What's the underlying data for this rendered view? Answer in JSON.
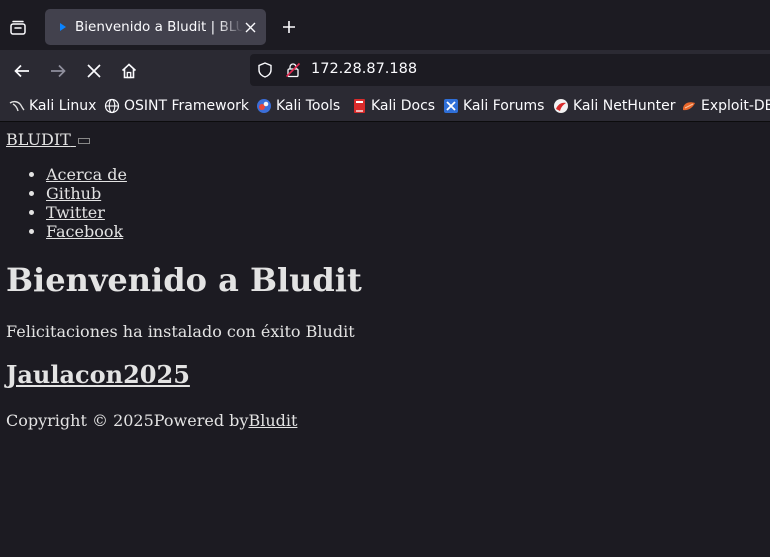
{
  "browser": {
    "tab": {
      "title": "Bienvenido a Bludit | BLUDIT"
    },
    "address_bar": {
      "url": "172.28.87.188"
    },
    "bookmarks": [
      {
        "label": "Kali Linux",
        "icon": "kali-dragon-icon"
      },
      {
        "label": "OSINT Framework",
        "icon": "globe-icon"
      },
      {
        "label": "Kali Tools",
        "icon": "kali-tools-icon"
      },
      {
        "label": "Kali Docs",
        "icon": "kali-docs-icon"
      },
      {
        "label": "Kali Forums",
        "icon": "kali-forums-icon"
      },
      {
        "label": "Kali NetHunter",
        "icon": "nethunter-icon"
      },
      {
        "label": "Exploit-DB",
        "icon": "exploit-db-icon"
      }
    ],
    "colors": {
      "tab_bg": "#42414d",
      "toolbar_bg": "#2b2a33",
      "page_bg": "#1c1b22",
      "text": "#fbfbfe"
    }
  },
  "page": {
    "brand": "BLUDIT",
    "nav": [
      {
        "label": "Acerca de"
      },
      {
        "label": " Github"
      },
      {
        "label": " Twitter"
      },
      {
        "label": " Facebook"
      }
    ],
    "hero_title": "Bienvenido a Bludit",
    "hero_description": "Felicitaciones ha instalado con éxito Bludit",
    "post_title": "Jaulacon2025",
    "footer": {
      "copyright": "Copyright © 2025",
      "powered_by": "Powered by",
      "powered_link": "Bludit"
    }
  }
}
